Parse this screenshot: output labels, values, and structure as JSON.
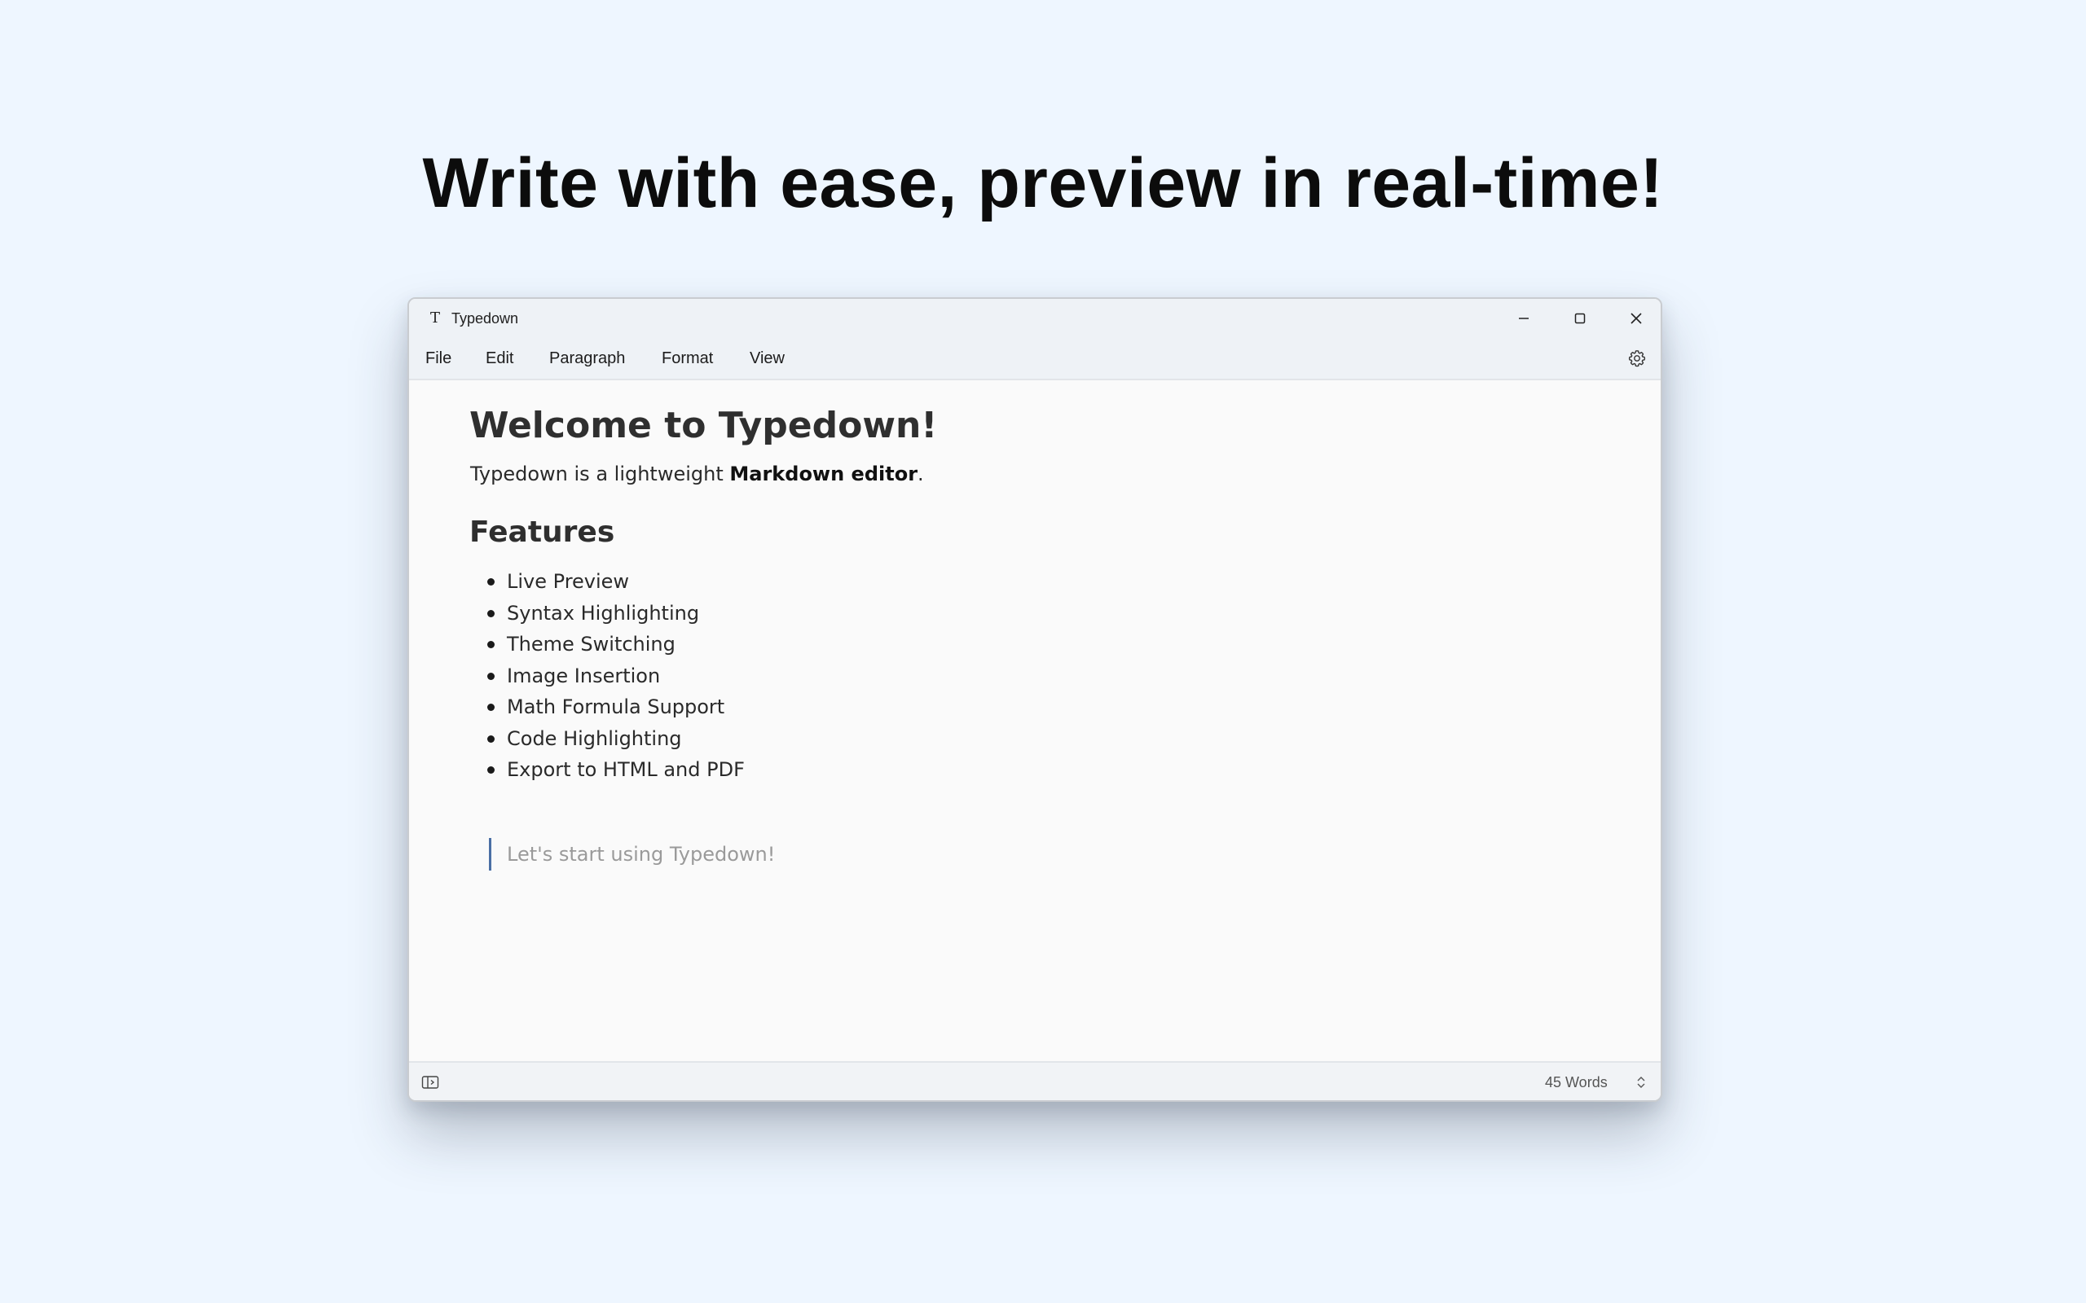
{
  "hero": {
    "title": "Write with ease, preview in real-time!"
  },
  "window": {
    "app_icon_glyph": "T",
    "app_name": "Typedown",
    "controls": {
      "minimize": "minimize-icon",
      "maximize": "maximize-icon",
      "close": "close-icon"
    }
  },
  "menubar": {
    "items": [
      {
        "label": "File"
      },
      {
        "label": "Edit"
      },
      {
        "label": "Paragraph"
      },
      {
        "label": "Format"
      },
      {
        "label": "View"
      }
    ],
    "settings_icon": "gear-icon"
  },
  "document": {
    "heading": "Welcome to Typedown!",
    "intro_before": "Typedown is a lightweight ",
    "intro_bold": "Markdown editor",
    "intro_after": ".",
    "section_heading": "Features",
    "features": [
      "Live Preview",
      "Syntax Highlighting",
      "Theme Switching",
      "Image Insertion",
      "Math Formula Support",
      "Code Highlighting",
      "Export to HTML and PDF"
    ],
    "blockquote": "Let's start using Typedown!"
  },
  "statusbar": {
    "sidebar_icon": "sidebar-toggle-icon",
    "word_count": "45 Words",
    "count_mode_icon": "chevron-up-down-icon"
  },
  "colors": {
    "background": "#eef6ff",
    "window": "#fafafa",
    "titlebar": "#eef2f6",
    "quote_bar": "#4a6fa5",
    "quote_text": "#9a9a9a"
  }
}
